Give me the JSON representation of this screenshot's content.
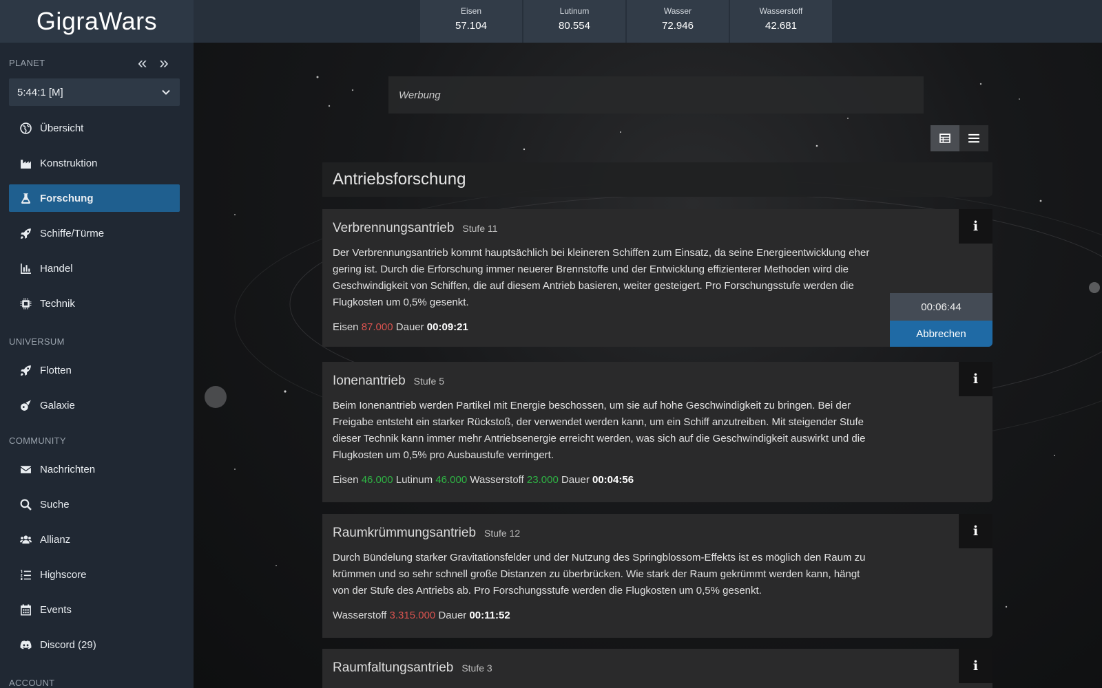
{
  "app": {
    "title": "GigraWars"
  },
  "sidebar": {
    "planet_header": "PLANET",
    "planet_prev_icon": "double-chevron-left-icon",
    "planet_next_icon": "double-chevron-right-icon",
    "planet_select": {
      "value": "5:44:1 [M]"
    },
    "planet_items": [
      {
        "label": "Übersicht",
        "icon": "globe-icon"
      },
      {
        "label": "Konstruktion",
        "icon": "industry-icon"
      },
      {
        "label": "Forschung",
        "icon": "flask-icon",
        "active": true
      },
      {
        "label": "Schiffe/Türme",
        "icon": "rocket-icon"
      },
      {
        "label": "Handel",
        "icon": "chart-icon"
      },
      {
        "label": "Technik",
        "icon": "chip-icon"
      }
    ],
    "universe_header": "UNIVERSUM",
    "universe_items": [
      {
        "label": "Flotten",
        "icon": "rocket-icon"
      },
      {
        "label": "Galaxie",
        "icon": "meteor-icon"
      }
    ],
    "community_header": "COMMUNITY",
    "community_items": [
      {
        "label": "Nachrichten",
        "icon": "envelope-icon"
      },
      {
        "label": "Suche",
        "icon": "search-icon"
      },
      {
        "label": "Allianz",
        "icon": "users-icon"
      },
      {
        "label": "Highscore",
        "icon": "list-ol-icon"
      },
      {
        "label": "Events",
        "icon": "calendar-icon"
      },
      {
        "label": "Discord (29)",
        "icon": "discord-icon"
      }
    ],
    "account_header": "ACCOUNT"
  },
  "resources": [
    {
      "name": "Eisen",
      "value": "57.104"
    },
    {
      "name": "Lutinum",
      "value": "80.554"
    },
    {
      "name": "Wasser",
      "value": "72.946"
    },
    {
      "name": "Wasserstoff",
      "value": "42.681"
    }
  ],
  "main": {
    "ad_label": "Werbung",
    "category_title": "Antriebsforschung",
    "info_label": "i",
    "research": [
      {
        "name": "Verbrennungsantrieb",
        "level": "Stufe 11",
        "description": "Der Verbrennungsantrieb kommt hauptsächlich bei kleineren Schiffen zum Einsatz, da seine Energieentwicklung eher gering ist. Durch die Erforschung immer neuerer Brennstoffe und der Entwicklung effizienterer Methoden wird die Geschwindigkeit von Schiffen, die auf diesem Antrieb basieren, weiter gesteigert. Pro Forschungsstufe werden die Flugkosten um 0,5% gesenkt.",
        "costs": [
          {
            "label": "Eisen",
            "amount": "87.000",
            "status": "insufficient"
          }
        ],
        "duration_label": "Dauer",
        "duration": "00:09:21",
        "timer": "00:06:44",
        "abort_label": "Abbrechen"
      },
      {
        "name": "Ionenantrieb",
        "level": "Stufe 5",
        "description": "Beim Ionenantrieb werden Partikel mit Energie beschossen, um sie auf hohe Geschwindigkeit zu bringen. Bei der Freigabe entsteht ein starker Rückstoß, der verwendet werden kann, um ein Schiff anzutreiben. Mit steigender Stufe dieser Technik kann immer mehr Antriebsenergie erreicht werden, was sich auf die Geschwindigkeit auswirkt und die Flugkosten um 0,5% pro Ausbaustufe verringert.",
        "costs": [
          {
            "label": "Eisen",
            "amount": "46.000",
            "status": "sufficient"
          },
          {
            "label": "Lutinum",
            "amount": "46.000",
            "status": "sufficient"
          },
          {
            "label": "Wasserstoff",
            "amount": "23.000",
            "status": "sufficient"
          }
        ],
        "duration_label": "Dauer",
        "duration": "00:04:56"
      },
      {
        "name": "Raumkrümmungsantrieb",
        "level": "Stufe 12",
        "description": "Durch Bündelung starker Gravitationsfelder und der Nutzung des Springblossom-Effekts ist es möglich den Raum zu krümmen und so sehr schnell große Distanzen zu überbrücken. Wie stark der Raum gekrümmt werden kann, hängt von der Stufe des Antriebs ab. Pro Forschungsstufe werden die Flugkosten um 0,5% gesenkt.",
        "costs": [
          {
            "label": "Wasserstoff",
            "amount": "3.315.000",
            "status": "insufficient"
          }
        ],
        "duration_label": "Dauer",
        "duration": "00:11:52"
      },
      {
        "name": "Raumfaltungsantrieb",
        "level": "Stufe 3"
      }
    ]
  },
  "colors": {
    "sidebar_bg": "#202833",
    "active_nav": "#1f5f8f",
    "insufficient": "#d9534f",
    "sufficient": "#2fb344",
    "abort_button": "#1f6aa5"
  }
}
